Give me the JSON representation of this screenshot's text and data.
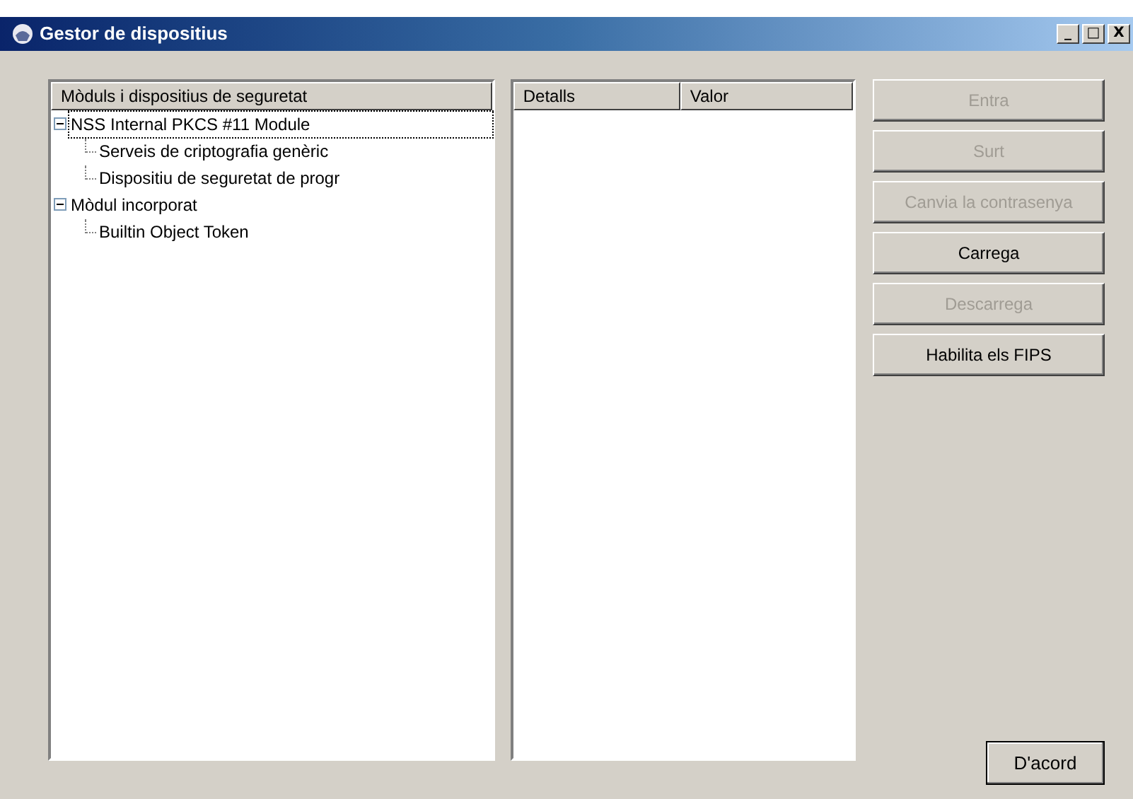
{
  "window": {
    "title": "Gestor de dispositius",
    "controls": [
      "_",
      "□",
      "X"
    ]
  },
  "tree": {
    "header": "Mòduls i dispositius de seguretat",
    "items": [
      {
        "label": "NSS Internal PKCS #11 Module",
        "expanded": true,
        "selected": true,
        "children": [
          {
            "label": "Serveis de criptografia genèric",
            "selected": false
          },
          {
            "label": "Dispositiu de seguretat de progr",
            "selected": false
          }
        ]
      },
      {
        "label": "Mòdul incorporat",
        "expanded": true,
        "selected": false,
        "children": [
          {
            "label": "Builtin Object Token",
            "selected": false
          }
        ]
      }
    ]
  },
  "details": {
    "columns": [
      "Detalls",
      "Valor"
    ]
  },
  "buttons": [
    {
      "label": "Entra",
      "disabled": true
    },
    {
      "label": "Surt",
      "disabled": true
    },
    {
      "label": "Canvia la contrasenya",
      "disabled": true
    },
    {
      "label": "Carrega",
      "disabled": false
    },
    {
      "label": "Descarrega",
      "disabled": true
    },
    {
      "label": "Habilita els FIPS",
      "disabled": false
    }
  ],
  "ok_button": "D'acord"
}
